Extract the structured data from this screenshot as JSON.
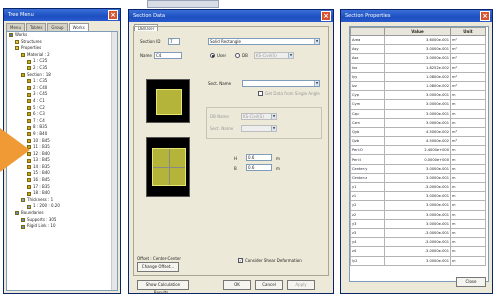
{
  "tree_window": {
    "title": "Tree Menu",
    "tabs": [
      "Menu",
      "Tables",
      "Group",
      "Works"
    ],
    "items": [
      {
        "label": "Works",
        "indent": 0,
        "icon": "root"
      },
      {
        "label": "Structures",
        "indent": 1,
        "icon": "folder"
      },
      {
        "label": "Properties",
        "indent": 1,
        "icon": "folder"
      },
      {
        "label": "Material : 2",
        "indent": 2,
        "icon": "mat"
      },
      {
        "label": "1 : C25",
        "indent": 3,
        "icon": "mat"
      },
      {
        "label": "2 : C35",
        "indent": 3,
        "icon": "mat"
      },
      {
        "label": "Section : 18",
        "indent": 2,
        "icon": "sec"
      },
      {
        "label": "1 : C35",
        "indent": 3,
        "icon": "sec"
      },
      {
        "label": "2 : C40",
        "indent": 3,
        "icon": "sec"
      },
      {
        "label": "3 : C45",
        "indent": 3,
        "icon": "sec"
      },
      {
        "label": "4 : C1",
        "indent": 3,
        "icon": "sec"
      },
      {
        "label": "5 : C2",
        "indent": 3,
        "icon": "sec"
      },
      {
        "label": "6 : C3",
        "indent": 3,
        "icon": "sec"
      },
      {
        "label": "7 : C4",
        "indent": 3,
        "icon": "sec"
      },
      {
        "label": "8 : B35",
        "indent": 3,
        "icon": "sec"
      },
      {
        "label": "9 : B40",
        "indent": 3,
        "icon": "sec"
      },
      {
        "label": "10 : B45",
        "indent": 3,
        "icon": "sec"
      },
      {
        "label": "11 : B35",
        "indent": 3,
        "icon": "sec"
      },
      {
        "label": "12 : B40",
        "indent": 3,
        "icon": "sec"
      },
      {
        "label": "13 : B45",
        "indent": 3,
        "icon": "sec"
      },
      {
        "label": "14 : B35",
        "indent": 3,
        "icon": "sec"
      },
      {
        "label": "15 : B40",
        "indent": 3,
        "icon": "sec"
      },
      {
        "label": "16 : B45",
        "indent": 3,
        "icon": "sec"
      },
      {
        "label": "17 : B35",
        "indent": 3,
        "icon": "sec"
      },
      {
        "label": "18 : B40",
        "indent": 3,
        "icon": "sec"
      },
      {
        "label": "Thickness : 1",
        "indent": 2,
        "icon": "thk"
      },
      {
        "label": "1 : 200 : 0.20",
        "indent": 3,
        "icon": "thk"
      },
      {
        "label": "Boundaries",
        "indent": 1,
        "icon": "bnd"
      },
      {
        "label": "Supports : 305",
        "indent": 2,
        "icon": "bnd"
      },
      {
        "label": "Rigid Link : 10",
        "indent": 2,
        "icon": "bnd"
      }
    ]
  },
  "section_window": {
    "title": "Section Data",
    "tab": "DB/User",
    "section_id_label": "Section ID",
    "section_id_value": "7",
    "shape_value": "Solid Rectangle",
    "name_label": "Name",
    "name_value": "C4",
    "radio_user": "User",
    "radio_db": "DB",
    "db_value": "KS-Civil(S)",
    "sect_name_label": "Sect. Name",
    "get_data_label": "Get Data from Single Angle",
    "db_name_label": "DB Name",
    "db_name_value": "KS-Civil(S)",
    "sect_name2_label": "Sect. Name",
    "h_label": "H",
    "h_value": "0.6",
    "h_unit": "m",
    "b_label": "B",
    "b_value": "0.6",
    "b_unit": "m",
    "consider_shear": "Consider Shear Deformation",
    "offset_label": "Offset : Center-Center",
    "change_offset": "Change Offset...",
    "show_calc": "Show Calculation Results...",
    "ok": "OK",
    "cancel": "Cancel",
    "apply": "Apply"
  },
  "properties_window": {
    "title": "Section Properties",
    "headers": [
      "",
      "Value",
      "Unit"
    ],
    "rows": [
      {
        "name": "Area",
        "value": "3.6000e-001",
        "unit": "m²"
      },
      {
        "name": "Asy",
        "value": "3.0000e-001",
        "unit": "m²"
      },
      {
        "name": "Asz",
        "value": "3.0000e-001",
        "unit": "m²"
      },
      {
        "name": "Ixx",
        "value": "1.8252e-002",
        "unit": "m⁴"
      },
      {
        "name": "Iyy",
        "value": "1.0800e-002",
        "unit": "m⁴"
      },
      {
        "name": "Izz",
        "value": "1.0800e-002",
        "unit": "m⁴"
      },
      {
        "name": "Cyp",
        "value": "3.0000e-001",
        "unit": "m"
      },
      {
        "name": "Cym",
        "value": "3.0000e-001",
        "unit": "m"
      },
      {
        "name": "Czp",
        "value": "3.0000e-001",
        "unit": "m"
      },
      {
        "name": "Czm",
        "value": "3.0000e-001",
        "unit": "m"
      },
      {
        "name": "Qyb",
        "value": "4.5000e-002",
        "unit": "m³"
      },
      {
        "name": "Qzb",
        "value": "4.5000e-002",
        "unit": "m³"
      },
      {
        "name": "Peri:O",
        "value": "2.4000e+000",
        "unit": "m"
      },
      {
        "name": "Peri:I",
        "value": "0.0000e+000",
        "unit": "m"
      },
      {
        "name": "Center:y",
        "value": "3.0000e-001",
        "unit": "m"
      },
      {
        "name": "Center:z",
        "value": "3.0000e-001",
        "unit": "m"
      },
      {
        "name": "y1",
        "value": "-3.0000e-001",
        "unit": "m"
      },
      {
        "name": "z1",
        "value": "3.0000e-001",
        "unit": "m"
      },
      {
        "name": "y2",
        "value": "3.0000e-001",
        "unit": "m"
      },
      {
        "name": "z2",
        "value": "3.0000e-001",
        "unit": "m"
      },
      {
        "name": "y3",
        "value": "3.0000e-001",
        "unit": "m"
      },
      {
        "name": "z3",
        "value": "-3.0000e-001",
        "unit": "m"
      },
      {
        "name": "y4",
        "value": "-3.0000e-001",
        "unit": "m"
      },
      {
        "name": "z4",
        "value": "-3.0000e-001",
        "unit": "m"
      },
      {
        "name": "ly2",
        "value": "3.0000e-001",
        "unit": "m"
      }
    ],
    "close_label": "Close"
  },
  "colors": {
    "title_bar": "#1c4fc0",
    "close_button": "#d8542f",
    "window_bg": "#ece9d8",
    "arrow": "#f09a36",
    "section_fill": "#b4b43a"
  }
}
